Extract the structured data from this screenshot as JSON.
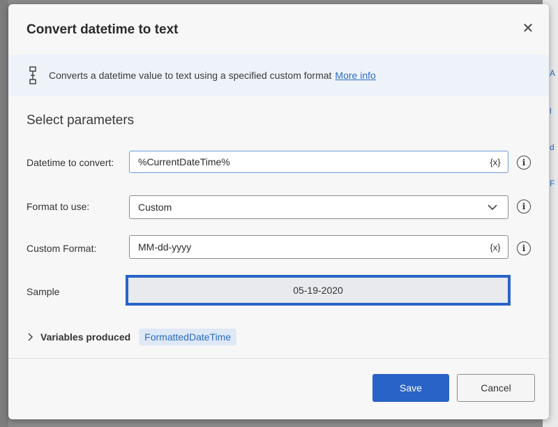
{
  "dialog": {
    "title": "Convert datetime to text",
    "close_glyph": "✕"
  },
  "banner": {
    "icon": "flow-icon",
    "text": "Converts a datetime value to text using a specified custom format",
    "link": "More info"
  },
  "section_title": "Select parameters",
  "fields": {
    "datetime": {
      "label": "Datetime to convert:",
      "value": "%CurrentDateTime%",
      "var_button": "{x}"
    },
    "format": {
      "label": "Format to use:",
      "value": "Custom"
    },
    "custom_format": {
      "label": "Custom Format:",
      "value": "MM-dd-yyyy",
      "var_button": "{x}"
    },
    "sample": {
      "label": "Sample",
      "value": "05-19-2020"
    }
  },
  "info_glyph": "i",
  "variables": {
    "label": "Variables produced",
    "chip": "FormattedDateTime"
  },
  "buttons": {
    "save": "Save",
    "cancel": "Cancel"
  },
  "colors": {
    "primary": "#2a63c7",
    "link": "#2b6cc4",
    "banner_bg": "#eef3fa",
    "chip_bg": "#dfe8f6"
  }
}
